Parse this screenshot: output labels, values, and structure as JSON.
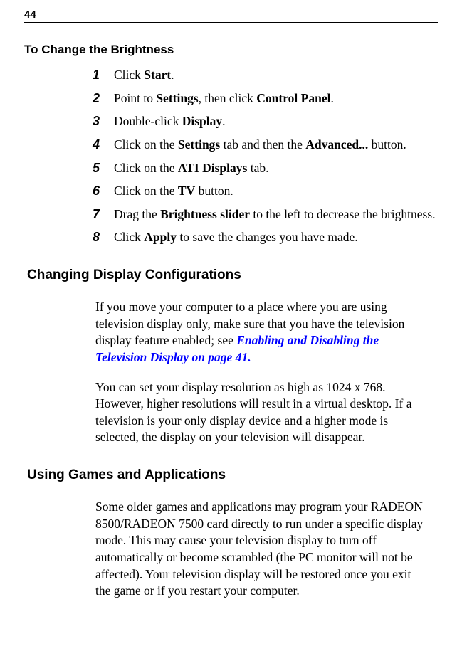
{
  "page_number": "44",
  "section1": {
    "title": "To Change the Brightness",
    "steps": [
      {
        "num": "1",
        "text": "Click <b>Start</b>."
      },
      {
        "num": "2",
        "text": "Point to <b>Settings</b>, then click <b>Control Panel</b>."
      },
      {
        "num": "3",
        "text": "Double-click <b>Display</b>."
      },
      {
        "num": "4",
        "text": "Click on the <b>Settings</b> tab and then the <b>Advanced...</b> button."
      },
      {
        "num": "5",
        "text": "Click on the <b>ATI Displays</b> tab."
      },
      {
        "num": "6",
        "text": "Click on the <b>TV</b> button."
      },
      {
        "num": "7",
        "text": "Drag the <b>Brightness slider</b> to the left to decrease the brightness."
      },
      {
        "num": "8",
        "text": "Click <b>Apply</b> to save the changes you have made."
      }
    ]
  },
  "section2": {
    "heading": "Changing Display Configurations",
    "para1_prefix": "If you move your computer to a place where you are using television display only, make sure that you have the television display feature enabled; see ",
    "para1_xref": "Enabling and Disabling the Television Display on page 41.",
    "para2": "You can set your display resolution as high as 1024 x 768. However, higher resolutions will result in a virtual desktop. If a television is your only display device and a higher mode is selected, the display on your television will disappear."
  },
  "section3": {
    "heading": "Using Games and Applications",
    "para1": "Some older games and applications may program your RADEON 8500/RADEON 7500 card directly to run under a specific display mode. This may cause your television display to turn off automatically or become scrambled (the PC monitor will not be affected). Your television display will be restored once you exit the game or if you restart your computer."
  }
}
